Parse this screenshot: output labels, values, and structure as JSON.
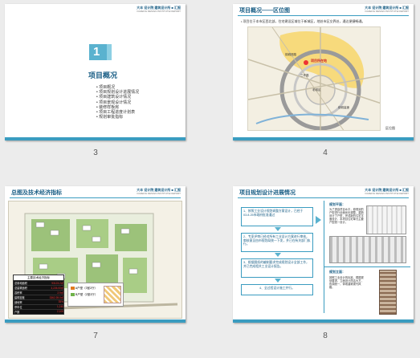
{
  "slides": [
    {
      "page": "3",
      "brand": "大丰 设计院 建筑设计所 ■ 汇报",
      "brand_sub": "DAFENG DESIGN INSTITUTE REPORT",
      "section_number": "1",
      "section_title": "项目概况",
      "items": [
        "项目概况",
        "项目规划设计进展情况",
        "项目建筑设计情况",
        "项目景观设计情况",
        "装修样板房",
        "项目工程进度计划表",
        "规划审批指标"
      ]
    },
    {
      "page": "4",
      "title": "项目概况——区位图",
      "bullet": "•  项目位于本市区西北部，住宅建设区域位于新城区，地处市区交界处，通达便捷畅通。",
      "map_labels": [
        "项目所在地",
        "锦城西路",
        "老城区",
        "三环路",
        "绕城高速"
      ],
      "map_caption": "区位图"
    },
    {
      "page": "7",
      "title": "总图及技术经济指标",
      "table_title": "主要技术经济指标",
      "table_rows": [
        [
          "总用地面积",
          "93123.2㎡"
        ],
        [
          "总建筑面积",
          "3,226.00㎡"
        ],
        [
          "容积率",
          "2.9㎡"
        ],
        [
          "建筑密度",
          "3362.39.0㎡"
        ],
        [
          "绿地率",
          "35%"
        ],
        [
          "停车位",
          "1,240"
        ],
        [
          "户数",
          "2,100"
        ]
      ],
      "legend_items": [
        "A户型（3室2厅）",
        "B户型（2室2厅）"
      ]
    },
    {
      "page": "8",
      "title": "项目规划设计进展情况",
      "steps": [
        "1、按照工业设计规划调整方案设计，已经于03.8.25市政府批准通过",
        "2、专家评审已经对所有工业设计方案进行审核，审核意见由市规划局统一下发，并已在有关部门执行。",
        "3、根据图纸的编制要求完成规划设计全部工作，并已完成相关工业设计报告。",
        "4、全过程设计施工并行。"
      ],
      "panel_top_title": "规划平面：",
      "panel_top_text": "为了提高项目水平，原规划的户型进行全面优化调整，重新设计了户型，完成新的住宅平面设计，本项目住宅单元主要户型统一设计。",
      "panel_bottom_title": "规划立面：",
      "panel_bottom_text": "按照工业设计的标准，根据规划要求，立面设计简洁大方，色调统一，体现建筑现代风格。"
    }
  ],
  "colors": {
    "accent": "#3a9cc0",
    "title": "#1b5f86",
    "orange": "#e07a1f"
  }
}
